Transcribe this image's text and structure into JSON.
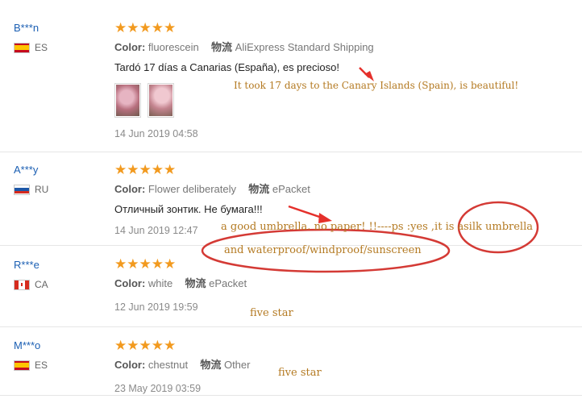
{
  "colors": {
    "star": "#f29a1f",
    "username": "#1b5fb3",
    "annotation": "#b47a22",
    "annotation_red": "#cc2f2a",
    "circle": "#d43a35"
  },
  "labels": {
    "color": "Color:",
    "shipping": "物流"
  },
  "reviews": [
    {
      "user": "B***n",
      "country": "ES",
      "flag": "spain-flag-icon",
      "rating": 5,
      "color": "fluorescein",
      "shipping": "AliExpress Standard Shipping",
      "text": "Tardó 17 días a Canarias (España), es precioso!",
      "date": "14 Jun 2019 04:58",
      "images": 2
    },
    {
      "user": "A***y",
      "country": "RU",
      "flag": "russia-flag-icon",
      "rating": 5,
      "color": "Flower deliberately",
      "shipping": "ePacket",
      "text": "Отличный зонтик. Не бумага!!!",
      "date": "14 Jun 2019 12:47",
      "images": 0
    },
    {
      "user": "R***e",
      "country": "CA",
      "flag": "canada-flag-icon",
      "rating": 5,
      "color": "white",
      "shipping": "ePacket",
      "text": "",
      "date": "12 Jun 2019 19:59",
      "images": 0
    },
    {
      "user": "M***o",
      "country": "ES",
      "flag": "spain-flag-icon",
      "rating": 5,
      "color": "chestnut",
      "shipping": "Other",
      "text": "",
      "date": "23 May 2019 03:59",
      "images": 0
    }
  ],
  "annotations": {
    "review1": "It took 17 days to the Canary Islands (Spain), is beautiful!",
    "review2_line1_a": "a good umbrella. no paper! !!----ps :yes ,it is a",
    "review2_line1_b": "silk umbrella",
    "review2_line2": "and waterproof/windproof/sunscreen",
    "review3": "five star",
    "review4": "five star"
  }
}
